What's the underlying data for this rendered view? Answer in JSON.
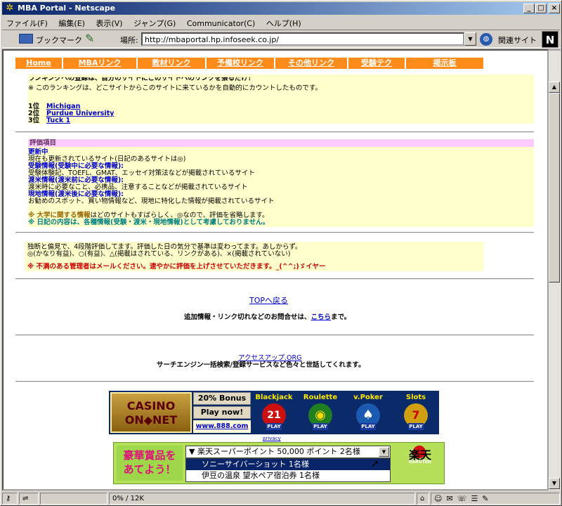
{
  "window": {
    "title": "MBA Portal - Netscape"
  },
  "menu": [
    "ファイル(F)",
    "編集(E)",
    "表示(V)",
    "ジャンプ(G)",
    "Communicator(C)",
    "ヘルプ(H)"
  ],
  "toolbar": {
    "bookmarks": "ブックマーク",
    "location_label": "場所:",
    "url": "http://mbaportal.hp.infoseek.co.jp/",
    "related": "関連サイト"
  },
  "nav": [
    "Home",
    "MBAリンク",
    "教材リンク",
    "予備校リンク",
    "その他リンク",
    "受験テク",
    "掲示板"
  ],
  "ranking": {
    "cut_line": "ランキングへの登録は、自分のサイトにこのサイトへのリンクを張るだけ！",
    "note": "※ このランキングは、どこサイトからこのサイトに来ているかを自動的にカウントしたものです。",
    "items": [
      {
        "rank": "1位",
        "name": "Michigan"
      },
      {
        "rank": "2位",
        "name": "Purdue University"
      },
      {
        "rank": "3位",
        "name": "Tuck 1"
      }
    ]
  },
  "criteria": {
    "header": "評価項目",
    "lines": [
      {
        "text": "更新中",
        "style": "blue"
      },
      {
        "text": "現在も更新されているサイト(日記のあるサイトは◎)",
        "style": "plain"
      },
      {
        "text": "受験情報(受験中に必要な情報):",
        "style": "blue"
      },
      {
        "text": "受験体験記、TOEFL、GMAT、エッセイ対策法などが掲載されているサイト",
        "style": "plain"
      },
      {
        "text": "渡米情報(渡米前に必要な情報):",
        "style": "blue"
      },
      {
        "text": "渡米時に必要なこと、必携品、注意することなどが掲載されているサイト",
        "style": "plain"
      },
      {
        "text": "現地情報(渡米後に必要な情報):",
        "style": "blue"
      },
      {
        "text": "お勧めのスポット、買い物情報など、現地に特化した情報が掲載されているサイト",
        "style": "plain"
      }
    ],
    "note1_bold": "※ 大学に関する情報",
    "note1_rest": "はどのサイトもすばらしく、◎なので、評価を省略します。",
    "note2": "※ 日記の内容は、各種情報(受験・渡米・現地情報)として考慮しておりません。"
  },
  "evaluation": {
    "line1": "独断と偏見で、4段階評価してます。評価した日の気分で基準は変わってます。あしからず。",
    "line2": "◎(かなり有益)、○(有益)、△(掲載はされている、リンクがある)、×(掲載されていない)",
    "line3": "※ 不満のある管理者はメールください。速やかに評価を上げさせていただきます。_(^^;)ゞイヤー"
  },
  "footer": {
    "top_link": "TOPへ戻る",
    "contact_text": "追加情報・リンク切れなどのお問合せは、",
    "contact_link": "こちら",
    "contact_end": "まで。",
    "access_link": "アクセスアップ.ORG",
    "access_desc": "サーチエンジン一括検索/登録サービスなど色々と世話してくれます。"
  },
  "casino_banner": {
    "logo_line1": "CASINO",
    "logo_line2": "ON◆NET",
    "bonus": "20% Bonus",
    "play": "Play now!",
    "url": "www.888.com",
    "games": [
      {
        "name": "Blackjack",
        "disc_color": "#cc1010",
        "glyph": "21"
      },
      {
        "name": "Roulette",
        "disc_color": "#208020",
        "glyph": "◉"
      },
      {
        "name": "v.Poker",
        "disc_color": "#1a5ab0",
        "glyph": "♠"
      },
      {
        "name": "Slots",
        "disc_color": "#d0a010",
        "glyph": "7"
      }
    ],
    "play_badge": "PLAY",
    "privacy": "privacy"
  },
  "rakuten_banner": {
    "left_line1": "豪華賞品を",
    "left_line2": "あてよう！",
    "selected": "▼ 楽天スーパーポイント 50,000 ポイント 2名様",
    "options": [
      "ソニーサイバーショット 1名様",
      "伊豆の温泉 望水ペア宿泊券 1名様"
    ],
    "logo": "楽天",
    "logo_small": "RAKUTEN"
  },
  "status": {
    "progress_text": "0% / 12K"
  },
  "colors": {
    "nav_bg": "#ff8c1a",
    "box_bg": "#ffffcc",
    "header_pink": "#ffccff",
    "title_blue": "#0a246a"
  }
}
